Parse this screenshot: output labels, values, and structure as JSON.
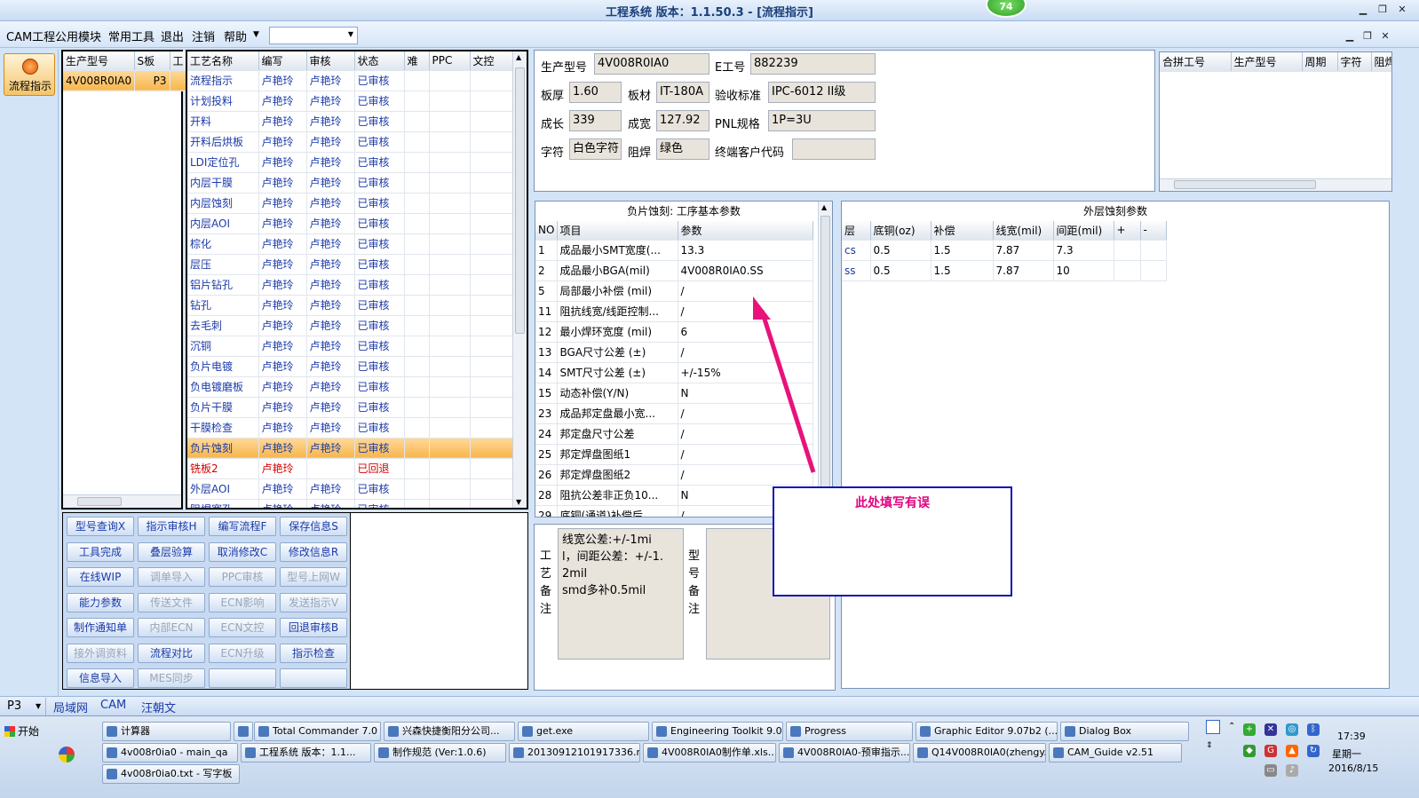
{
  "window": {
    "title": "工程系统  版本：1.1.50.3 - [流程指示]",
    "badge": "74"
  },
  "menu": [
    "CAM工程",
    "公用模块",
    "常用工具",
    "退出",
    "注销",
    "帮助"
  ],
  "left_strip": {
    "flow_button": "流程指示"
  },
  "model_list": {
    "headers": [
      "生产型号",
      "S板",
      "工"
    ],
    "rows": [
      [
        "4V008R0IA0",
        "P3"
      ]
    ]
  },
  "process": {
    "headers": [
      "工艺名称",
      "编写",
      "审核",
      "状态",
      "难",
      "PPC",
      "文控"
    ],
    "rows": [
      {
        "name": "流程指示",
        "w": "卢艳玲",
        "r": "卢艳玲",
        "s": "已审核"
      },
      {
        "name": "计划投料",
        "w": "卢艳玲",
        "r": "卢艳玲",
        "s": "已审核"
      },
      {
        "name": "开料",
        "w": "卢艳玲",
        "r": "卢艳玲",
        "s": "已审核"
      },
      {
        "name": "开料后烘板",
        "w": "卢艳玲",
        "r": "卢艳玲",
        "s": "已审核"
      },
      {
        "name": "LDI定位孔",
        "w": "卢艳玲",
        "r": "卢艳玲",
        "s": "已审核"
      },
      {
        "name": "内层干膜",
        "w": "卢艳玲",
        "r": "卢艳玲",
        "s": "已审核"
      },
      {
        "name": "内层蚀刻",
        "w": "卢艳玲",
        "r": "卢艳玲",
        "s": "已审核"
      },
      {
        "name": "内层AOI",
        "w": "卢艳玲",
        "r": "卢艳玲",
        "s": "已审核"
      },
      {
        "name": "棕化",
        "w": "卢艳玲",
        "r": "卢艳玲",
        "s": "已审核"
      },
      {
        "name": "层压",
        "w": "卢艳玲",
        "r": "卢艳玲",
        "s": "已审核"
      },
      {
        "name": "铝片钻孔",
        "w": "卢艳玲",
        "r": "卢艳玲",
        "s": "已审核"
      },
      {
        "name": "钻孔",
        "w": "卢艳玲",
        "r": "卢艳玲",
        "s": "已审核"
      },
      {
        "name": "去毛刺",
        "w": "卢艳玲",
        "r": "卢艳玲",
        "s": "已审核"
      },
      {
        "name": "沉铜",
        "w": "卢艳玲",
        "r": "卢艳玲",
        "s": "已审核"
      },
      {
        "name": "负片电镀",
        "w": "卢艳玲",
        "r": "卢艳玲",
        "s": "已审核"
      },
      {
        "name": "负电镀磨板",
        "w": "卢艳玲",
        "r": "卢艳玲",
        "s": "已审核"
      },
      {
        "name": "负片干膜",
        "w": "卢艳玲",
        "r": "卢艳玲",
        "s": "已审核"
      },
      {
        "name": "干膜检查",
        "w": "卢艳玲",
        "r": "卢艳玲",
        "s": "已审核"
      },
      {
        "name": "负片蚀刻",
        "w": "卢艳玲",
        "r": "卢艳玲",
        "s": "已审核",
        "sel": true
      },
      {
        "name": "铣板2",
        "w": "卢艳玲",
        "r": "",
        "s": "已回退",
        "red": true
      },
      {
        "name": "外层AOI",
        "w": "卢艳玲",
        "r": "卢艳玲",
        "s": "已审核"
      },
      {
        "name": "阻焊塞孔",
        "w": "卢艳玲",
        "r": "卢艳玲",
        "s": "已审核"
      }
    ]
  },
  "buttons": [
    [
      "型号查询X",
      "指示审核H",
      "编写流程F",
      "保存信息S"
    ],
    [
      "工具完成",
      "叠层验算",
      "取消修改C",
      "修改信息R"
    ],
    [
      "在线WIP",
      "调单导入",
      "PPC审核",
      "型号上网W"
    ],
    [
      "能力参数",
      "传送文件",
      "ECN影响",
      "发送指示V"
    ],
    [
      "制作通知单",
      "内部ECN",
      "ECN文控",
      "回退审核B"
    ],
    [
      "接外调资料",
      "流程对比",
      "ECN升级",
      "指示检查"
    ],
    [
      "信息导入",
      "MES同步",
      "",
      ""
    ]
  ],
  "buttons_disabled": [
    [
      false,
      false,
      false,
      false
    ],
    [
      false,
      false,
      false,
      false
    ],
    [
      false,
      true,
      true,
      true
    ],
    [
      false,
      true,
      true,
      true
    ],
    [
      false,
      true,
      true,
      false
    ],
    [
      true,
      false,
      true,
      false
    ],
    [
      false,
      true,
      false,
      false
    ]
  ],
  "info": {
    "model_label": "生产型号",
    "model": "4V008R0IA0",
    "e_label": "E工号",
    "e": "882239",
    "thick_label": "板厚",
    "thick": "1.60",
    "mat_label": "板材",
    "mat": "IT-180A",
    "std_label": "验收标准",
    "std": "IPC-6012 II级",
    "len_label": "成长",
    "len": "339",
    "wid_label": "成宽",
    "wid": "127.92",
    "pnl_label": "PNL规格",
    "pnl": "1P=3U",
    "char_label": "字符",
    "char": "白色字符",
    "mask_label": "阻焊",
    "mask": "绿色",
    "cust_label": "终端客户代码",
    "cust": ""
  },
  "combine": {
    "headers": [
      "合拼工号",
      "生产型号",
      "周期",
      "字符",
      "阻焊"
    ]
  },
  "basic": {
    "title": "负片蚀刻: 工序基本参数",
    "headers": [
      "NO",
      "项目",
      "参数"
    ],
    "rows": [
      [
        "1",
        "成品最小SMT宽度(...",
        "13.3"
      ],
      [
        "2",
        "成品最小BGA(mil)",
        "4V008R0IA0.SS"
      ],
      [
        "5",
        "局部最小补偿 (mil)",
        "/"
      ],
      [
        "11",
        "阻抗线宽/线距控制...",
        "/"
      ],
      [
        "12",
        "最小焊环宽度 (mil)",
        "6"
      ],
      [
        "13",
        "BGA尺寸公差 (±)",
        "/"
      ],
      [
        "14",
        "SMT尺寸公差 (±)",
        "+/-15%"
      ],
      [
        "15",
        "动态补偿(Y/N)",
        "N"
      ],
      [
        "23",
        "成品邦定盘最小宽...",
        "/"
      ],
      [
        "24",
        "邦定盘尺寸公差",
        "/"
      ],
      [
        "25",
        "邦定焊盘图纸1",
        "/"
      ],
      [
        "26",
        "邦定焊盘图纸2",
        "/"
      ],
      [
        "28",
        "阻抗公差非正负10...",
        "N"
      ],
      [
        "29",
        "底铜(通道)补偿后...",
        "/"
      ]
    ]
  },
  "outer": {
    "title": "外层蚀刻参数",
    "headers": [
      "层",
      "底铜(oz)",
      "补偿",
      "线宽(mil)",
      "间距(mil)",
      "+",
      "-"
    ],
    "rows": [
      [
        "cs",
        "0.5",
        "1.5",
        "7.87",
        "7.3",
        "",
        ""
      ],
      [
        "ss",
        "0.5",
        "1.5",
        "7.87",
        "10",
        "",
        ""
      ]
    ]
  },
  "remarks": {
    "process_label": "工艺备注",
    "process_text": "线宽公差:+/-1mil，间距公差：+/-1.2mil\nsmd多补0.5mil",
    "model_label": "型号备注"
  },
  "note": "此处填写有误",
  "status": {
    "combo": "P3",
    "items": [
      "局域网",
      "CAM",
      "汪朝文"
    ]
  },
  "taskbar": {
    "start": "开始",
    "row1": [
      "计算器",
      "",
      "Total Commander 7.0 ...",
      "兴森快捷衡阳分公司...",
      "get.exe",
      "Engineering Toolkit 9.0...",
      "Progress",
      "Graphic Editor 9.07b2 (...",
      "Dialog Box"
    ],
    "row2": [
      "4v008r0ia0 - main_qa",
      "工程系统  版本：1.1...",
      "制作规范 (Ver:1.0.6)",
      "20130912101917336.rt...",
      "4V008R0IA0制作单.xls...",
      "4V008R0IA0-预审指示...",
      "Q14V008R0IA0(zhengy...",
      "CAM_Guide v2.51"
    ],
    "row3": [
      "4v008r0ia0.txt - 写字板"
    ],
    "time": "17:39",
    "weekday": "星期一",
    "date": "2016/8/15"
  }
}
